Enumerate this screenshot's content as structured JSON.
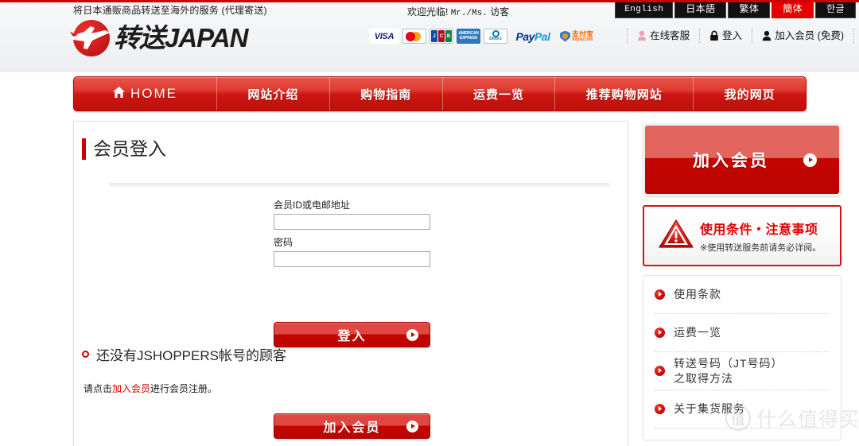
{
  "header": {
    "tagline": "将日本通贩商品转送至海外的服务 (代理寄送)",
    "welcome_prefix": "欢迎光临!",
    "welcome_mono": "Mr./Ms.",
    "welcome_suffix": "访客",
    "logo_text": "转送JAPAN",
    "logo_icon": "airplane-circle-logo"
  },
  "languages": [
    {
      "label": "English",
      "active": false
    },
    {
      "label": "日本語",
      "active": false
    },
    {
      "label": "繁体",
      "active": false
    },
    {
      "label": "簡体",
      "active": true
    },
    {
      "label": "한글",
      "active": false
    }
  ],
  "payments": [
    {
      "name": "VISA",
      "label": "VISA"
    },
    {
      "name": "MasterCard",
      "label": ""
    },
    {
      "name": "JCB",
      "label": "JCB"
    },
    {
      "name": "American Express",
      "label": "AMERICAN EXPRESS"
    },
    {
      "name": "Diners Club",
      "label": "Diners Club INTERNATIONAL"
    },
    {
      "name": "PayPal",
      "label": "PayPal"
    },
    {
      "name": "Alipay",
      "label": "支付宝 Alipay.com"
    }
  ],
  "utility_links": [
    {
      "label": "在线客服",
      "icon": "headset-operator-icon"
    },
    {
      "label": "登入",
      "icon": "lock-icon"
    },
    {
      "label": "加入会员 (免费)",
      "icon": "person-icon"
    }
  ],
  "nav": [
    {
      "label": "HOME",
      "icon": "home-icon"
    },
    {
      "label": "网站介绍",
      "icon": ""
    },
    {
      "label": "购物指南",
      "icon": ""
    },
    {
      "label": "运费一览",
      "icon": ""
    },
    {
      "label": "推荐购物网站",
      "icon": ""
    },
    {
      "label": "我的网页",
      "icon": ""
    }
  ],
  "main": {
    "page_title": "会员登入",
    "form": {
      "id_label": "会员ID或电邮地址",
      "id_value": "",
      "id_placeholder": "",
      "password_label": "密码",
      "password_value": "",
      "password_placeholder": "",
      "submit_label": "登入"
    },
    "no_account": {
      "heading": "还没有JSHOPPERS帐号的顾客",
      "sub_prefix": "请点击",
      "sub_link": "加入会员",
      "sub_suffix": "进行会员注册。",
      "join_button_label": "加入会员"
    }
  },
  "sidebar": {
    "join_button_label": "加入会员",
    "warning": {
      "title": "使用条件・注意事项",
      "subtitle": "※使用转送服务前请务必详阅。",
      "icon": "warning-triangle-icon"
    },
    "links": [
      {
        "label": "使用条款"
      },
      {
        "label": "运费一览"
      },
      {
        "label": "转送号码（JT号码）\n之取得方法"
      },
      {
        "label": "关于集货服务"
      }
    ]
  },
  "watermark": {
    "mark": "值",
    "text": "什么值得买"
  },
  "colors": {
    "brand_red": "#cc0000",
    "button_red_light": "#e04740",
    "button_red_dark": "#bd0300",
    "nav_red_top": "#e8564c",
    "nav_red_bottom": "#c10d08",
    "header_bg": "#f5f6f8",
    "link_red": "#e00000",
    "lang_tab_bg": "#111111",
    "lang_tab_active": "#e60000"
  }
}
